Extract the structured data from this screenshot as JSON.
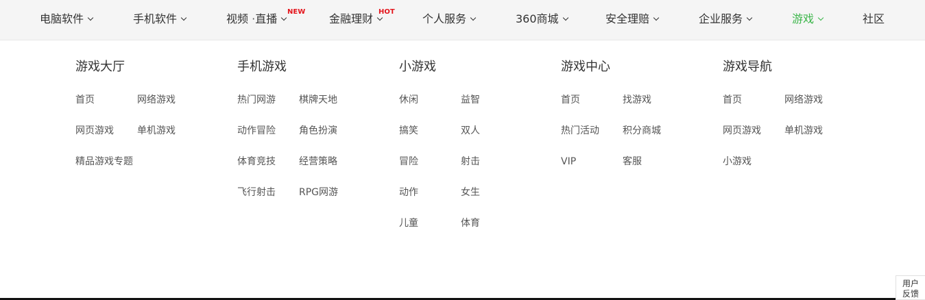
{
  "nav": {
    "items": [
      {
        "label": "电脑软件"
      },
      {
        "label": "手机软件"
      },
      {
        "label": "视频",
        "label2": "直播",
        "badge": "NEW"
      },
      {
        "label": "金融理财",
        "badge": "HOT"
      },
      {
        "label": "个人服务"
      },
      {
        "label": "360商城"
      },
      {
        "label": "安全理赔"
      },
      {
        "label": "企业服务"
      },
      {
        "label": "游戏"
      },
      {
        "label": "社区"
      }
    ],
    "separator": "·",
    "active_color": "#3cb64a",
    "badge_color": "#e4141b"
  },
  "dropdown": {
    "columns": [
      {
        "title": "游戏大厅",
        "links": [
          "首页",
          "网络游戏",
          "网页游戏",
          "单机游戏",
          "精品游戏专题"
        ]
      },
      {
        "title": "手机游戏",
        "links": [
          "热门网游",
          "棋牌天地",
          "动作冒险",
          "角色扮演",
          "体育竞技",
          "经营策略",
          "飞行射击",
          "RPG网游"
        ]
      },
      {
        "title": "小游戏",
        "links": [
          "休闲",
          "益智",
          "搞笑",
          "双人",
          "冒险",
          "射击",
          "动作",
          "女生",
          "儿童",
          "体育"
        ]
      },
      {
        "title": "游戏中心",
        "links": [
          "首页",
          "找游戏",
          "热门活动",
          "积分商城",
          "VIP",
          "客服"
        ]
      },
      {
        "title": "游戏导航",
        "links": [
          "首页",
          "网络游戏",
          "网页游戏",
          "单机游戏",
          "小游戏"
        ]
      }
    ]
  },
  "feedback": {
    "line1": "用户",
    "line2": "反馈"
  }
}
